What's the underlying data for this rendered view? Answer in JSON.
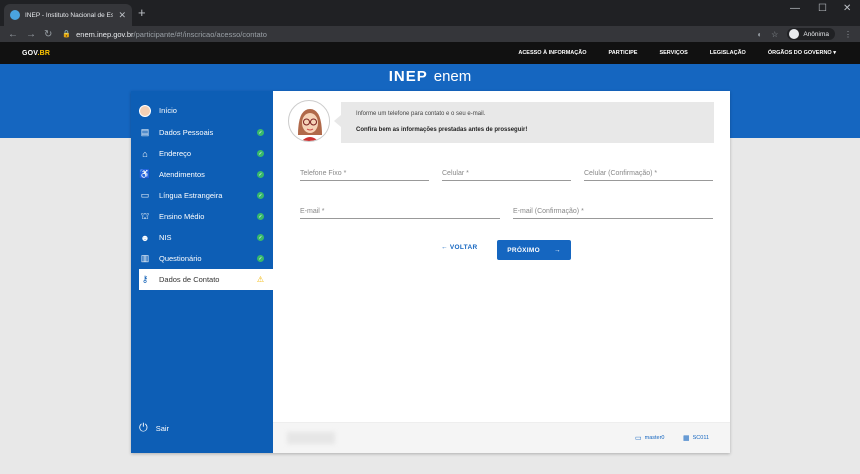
{
  "browser": {
    "tab_title": "INEP - Instituto Nacional de Est...",
    "new_tab": "+",
    "url_domain": "enem.inep.gov.br",
    "url_path": "/participante/#!/inscricao/acesso/contato",
    "profile": "Anônima",
    "icons": [
      "back-icon",
      "forward-icon",
      "reload-icon",
      "lock-icon",
      "star-icon",
      "menu-icon"
    ]
  },
  "gov": {
    "logo_a": "GOV",
    "logo_b": ".BR",
    "links": [
      "ACESSO À INFORMAÇÃO",
      "PARTICIPE",
      "SERVIÇOS",
      "LEGISLAÇÃO",
      "ÓRGÃOS DO GOVERNO"
    ]
  },
  "brand": {
    "inep": "INEP",
    "enem": "enem"
  },
  "sidebar": {
    "items": [
      {
        "label": "Início",
        "icon": "avatar-icon",
        "status": ""
      },
      {
        "label": "Dados Pessoais",
        "icon": "id-card-icon",
        "status": "ok"
      },
      {
        "label": "Endereço",
        "icon": "home-icon",
        "status": "ok"
      },
      {
        "label": "Atendimentos",
        "icon": "accessibility-icon",
        "status": "ok"
      },
      {
        "label": "Língua Estrangeira",
        "icon": "language-icon",
        "status": "ok"
      },
      {
        "label": "Ensino Médio",
        "icon": "school-icon",
        "status": "ok"
      },
      {
        "label": "NIS",
        "icon": "people-icon",
        "status": "ok"
      },
      {
        "label": "Questionário",
        "icon": "clipboard-icon",
        "status": "ok"
      },
      {
        "label": "Dados de Contato",
        "icon": "key-icon",
        "status": "warning"
      }
    ],
    "logout": "Sair"
  },
  "info": {
    "line1": "Informe um telefone para contato e o seu e-mail.",
    "line2": "Confira bem as informações prestadas antes de prosseguir!"
  },
  "form": {
    "phone": "Telefone Fixo *",
    "mobile": "Celular *",
    "mobile_confirm": "Celular (Confirmação) *",
    "email": "E-mail *",
    "email_confirm": "E-mail (Confirmação) *"
  },
  "actions": {
    "back": "← VOLTAR",
    "next": "PRÓXIMO",
    "next_arrow": "→"
  },
  "footer": {
    "server": "master0",
    "version": "SC011"
  },
  "colors": {
    "primary": "#1566c0",
    "sidebar": "#0d5eb5",
    "ok": "#38b96a",
    "warning": "#f2b705"
  }
}
